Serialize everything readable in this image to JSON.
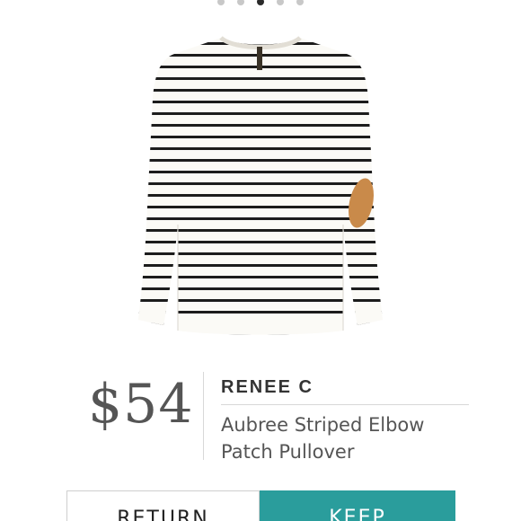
{
  "carousel": {
    "dot_count": 5,
    "active_index": 2
  },
  "product": {
    "image_icon": "striped-sweater-image",
    "price": "$54",
    "brand": "RENEE C",
    "name_line1": "Aubree Striped Elbow",
    "name_line2": "Patch Pullover"
  },
  "actions": {
    "return_label": "RETURN",
    "keep_label": "KEEP"
  },
  "colors": {
    "accent": "#2a9d9c",
    "patch": "#c98a4a",
    "stripe": "#1c1c1c",
    "fabric": "#fbfaf6"
  }
}
